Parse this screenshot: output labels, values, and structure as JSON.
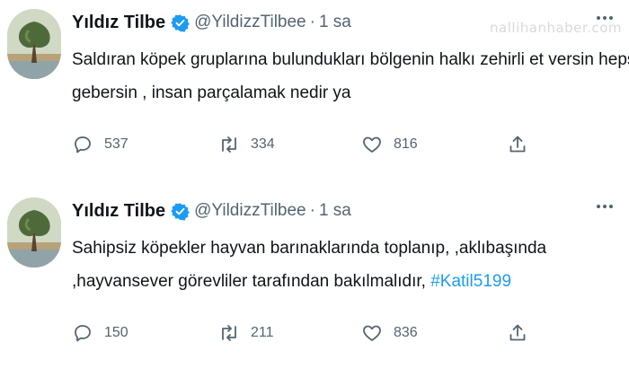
{
  "watermark": "nallihanhaber.com",
  "tweets": [
    {
      "author": {
        "name": "Yıldız Tilbe",
        "handle": "@YildizzTilbee",
        "separator": "·",
        "time": "1 sa"
      },
      "lines": [
        "Saldıran köpek gruplarına bulundukları bölgenin halkı zehirli et versin hepsi",
        "gebersin , insan parçalamak nedir ya"
      ],
      "hashtag": "",
      "actions": {
        "reply": "537",
        "retweet": "334",
        "like": "816"
      }
    },
    {
      "author": {
        "name": "Yıldız Tilbe",
        "handle": "@YildizzTilbee",
        "separator": "·",
        "time": "1 sa"
      },
      "lines": [
        "Sahipsiz köpekler hayvan barınaklarında toplanıp,   ,aklıbaşında",
        ",hayvansever görevliler tarafından bakılmalıdır,"
      ],
      "hashtag": "#Katil5199",
      "actions": {
        "reply": "150",
        "retweet": "211",
        "like": "836"
      }
    }
  ],
  "colors": {
    "text": "#0f1419",
    "secondary": "#536471",
    "accent": "#1d9bf0",
    "verified": "#1d9bf0"
  },
  "icons": [
    "reply-icon",
    "retweet-icon",
    "like-icon",
    "share-icon",
    "verified-badge-icon",
    "more-options-icon"
  ]
}
